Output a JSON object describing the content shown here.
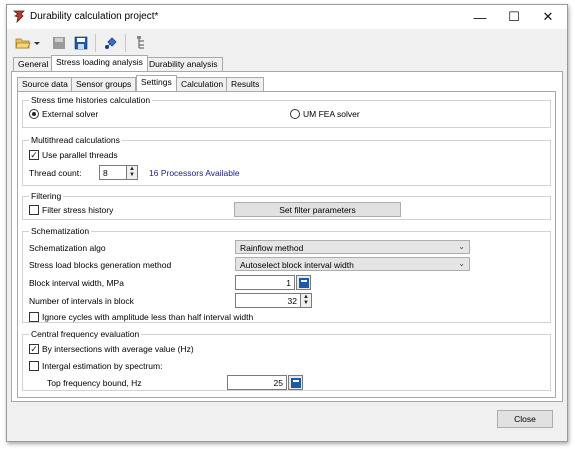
{
  "window": {
    "title": "Durability calculation project*",
    "controls": {
      "minimize": "—",
      "maximize": "☐",
      "close": "✕"
    }
  },
  "toolbar": {
    "items": [
      "open-folder-icon",
      "dropdown-arrow-icon",
      "save-disabled-icon",
      "save-icon",
      "run-icon",
      "tree-icon"
    ]
  },
  "main_tabs": [
    "General",
    "Stress loading analysis",
    "Durability analysis"
  ],
  "sub_tabs": [
    "Source data",
    "Sensor groups",
    "Settings",
    "Calculation",
    "Results"
  ],
  "stress_time_histories": {
    "title": "Stress time histories calculation",
    "external_solver": "External solver",
    "um_fea_solver": "UM FEA solver",
    "selected": "External solver"
  },
  "multithread": {
    "title": "Multithread calculations",
    "use_parallel_label": "Use parallel threads",
    "use_parallel_checked": true,
    "thread_count_label": "Thread count:",
    "thread_count_value": "8",
    "processors_text": "16 Processors Available"
  },
  "filtering": {
    "title": "Filtering",
    "filter_label": "Filter stress history",
    "filter_checked": false,
    "set_params_button": "Set filter parameters"
  },
  "schematization": {
    "title": "Schematization",
    "algo_label": "Schematization algo",
    "algo_value": "Rainflow method",
    "method_label": "Stress load blocks generation method",
    "method_value": "Autoselect block interval width",
    "block_width_label": "Block interval width, MPa",
    "block_width_value": "1",
    "intervals_label": "Number of intervals in block",
    "intervals_value": "32",
    "ignore_label": "Ignore cycles with amplitude less than half interval width",
    "ignore_checked": false
  },
  "central_frequency": {
    "title": "Central frequency evaluation",
    "by_intersections_label": "By intersections with average value (Hz)",
    "by_intersections_checked": true,
    "integral_label": "Intergal estimation by spectrum:",
    "integral_checked": false,
    "top_bound_label": "Top frequency bound, Hz",
    "top_bound_value": "25"
  },
  "footer": {
    "close_button": "Close"
  },
  "colors": {
    "processors_text": "#1a1a8c",
    "window_bg": "#f0f0f0",
    "accent_icon": "#1a5aa8"
  }
}
